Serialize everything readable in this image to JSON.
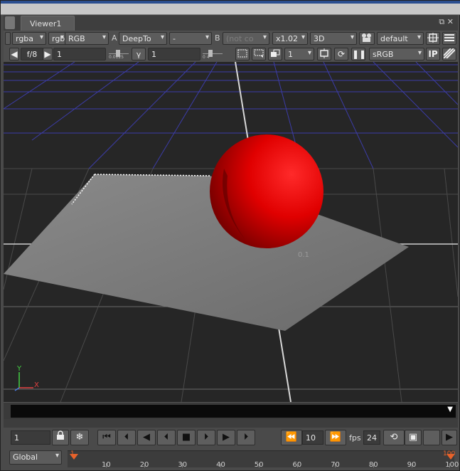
{
  "window": {
    "tab_label": "Viewer1",
    "restore_icon": "restore-icon",
    "close_icon": "close-icon"
  },
  "toolbar1": {
    "channels": "rgba",
    "layer_short": "rgb",
    "layer": "RGB",
    "a_label": "A",
    "a_input": "DeepTo",
    "a_op": "-",
    "b_label": "B",
    "b_input": "(not co",
    "zoom": "x1.02",
    "view_mode": "3D",
    "camera_icon": "camera-icon",
    "camera": "default"
  },
  "toolbar2": {
    "fstop": "f/8",
    "gain": "1",
    "gain_ticks": "0.0125",
    "gamma_label": "γ",
    "gamma": "1",
    "gamma_ticks": "0   4",
    "proxy_value": "1",
    "lut": "sRGB",
    "ip_label": "IP"
  },
  "viewport": {
    "label": "0.1",
    "axis_y": "Y",
    "axis_x": "X"
  },
  "playback": {
    "frame": "1",
    "step": "10",
    "fps_label": "fps",
    "fps": "24"
  },
  "timeline": {
    "range_mode": "Global",
    "start": "1",
    "end": "100",
    "ticks": [
      "10",
      "20",
      "30",
      "40",
      "50",
      "60",
      "70",
      "80",
      "90",
      "100"
    ]
  },
  "colors": {
    "sphere": "#d80000",
    "grid": "#3c3ca8",
    "plane": "#7a7a7a",
    "accent_orange": "#e8622a"
  }
}
